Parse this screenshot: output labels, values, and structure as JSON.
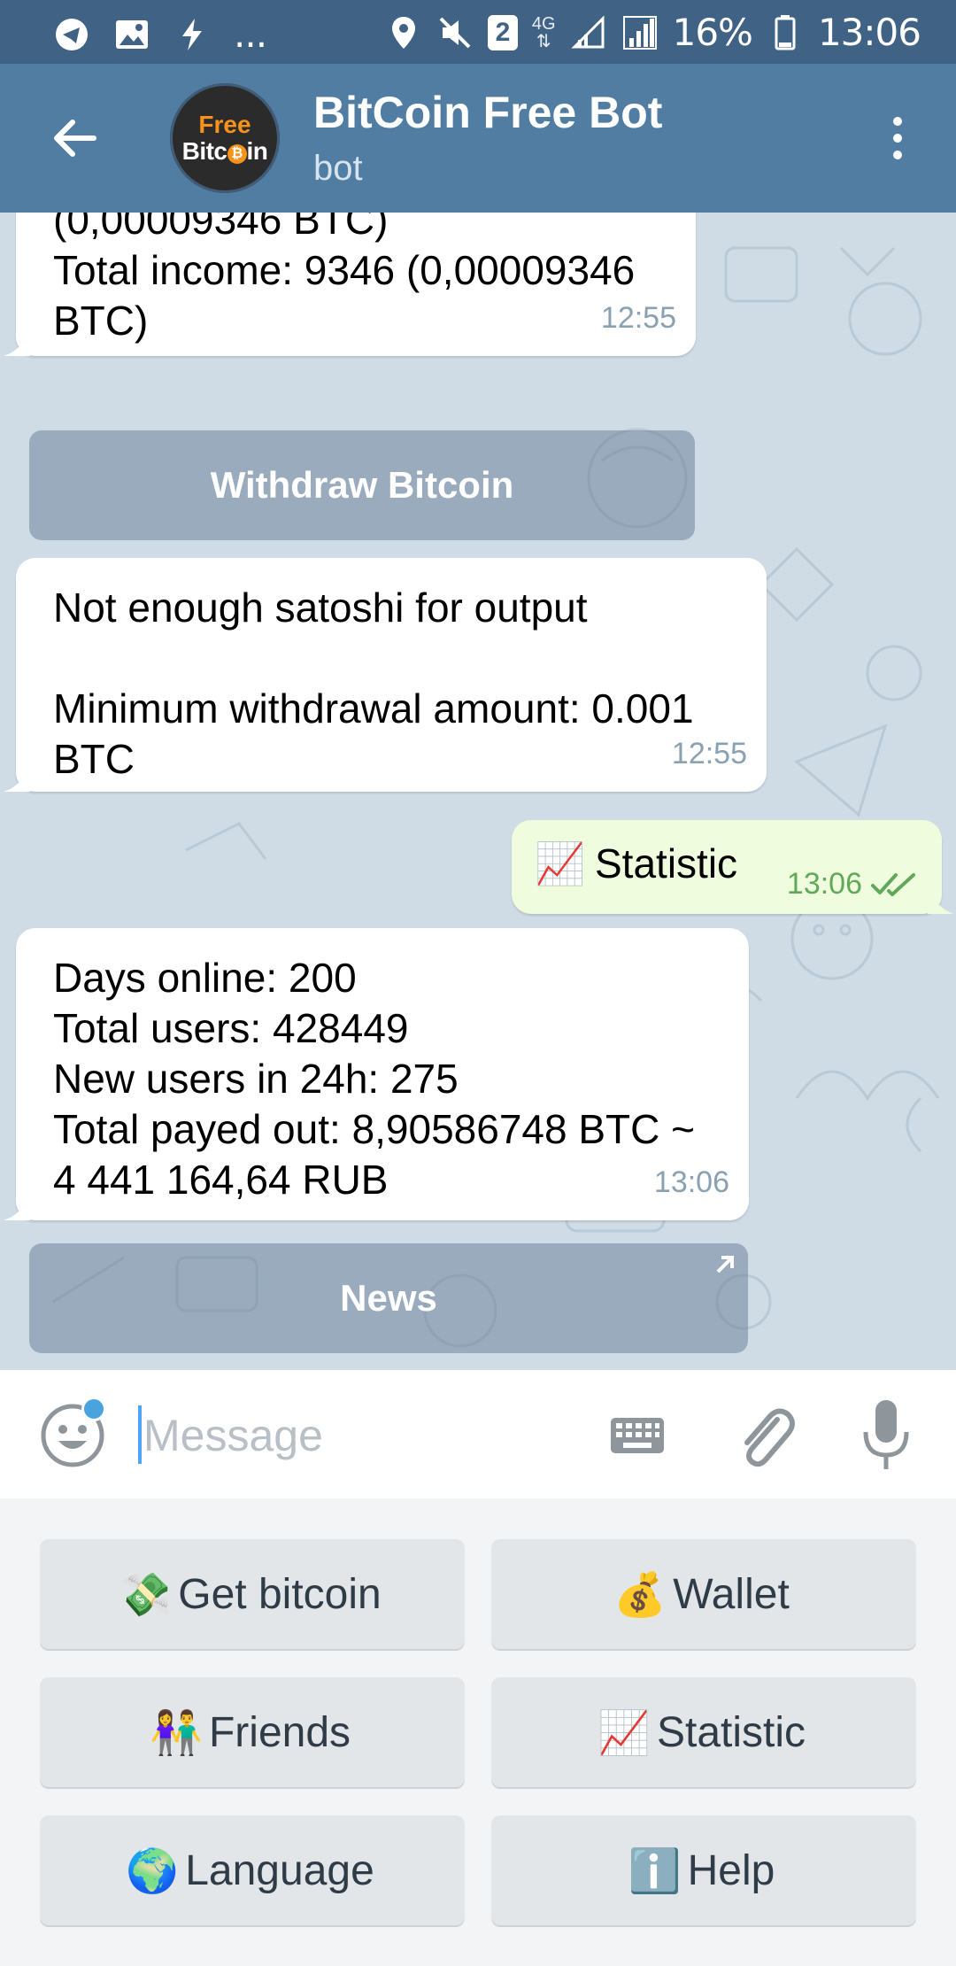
{
  "status_bar": {
    "left_icons": [
      "telegram-icon",
      "image-icon",
      "flash-icon"
    ],
    "more": "...",
    "sim": "2",
    "network": "4G",
    "battery": "16%",
    "time": "13:06"
  },
  "header": {
    "avatar_line1": "Free",
    "avatar_line2a": "Bitc",
    "avatar_coin": "₿",
    "avatar_line2b": "in",
    "title": "BitCoin Free Bot",
    "subtitle": "bot"
  },
  "messages": [
    {
      "cut_text": "(0,00009346 BTC)",
      "text": "Total income: 9346 (0,00009346\nBTC)",
      "time": "12:55"
    },
    {
      "text": "Not enough satoshi for output\n\nMinimum withdrawal amount: 0.001\nBTC",
      "time": "12:55"
    },
    {
      "emoji": "📈",
      "text": "Statistic",
      "time": "13:06"
    },
    {
      "text": "Days online: 200\nTotal users: 428449\nNew users in 24h: 275\nTotal payed out: 8,90586748 BTC ~\n4 441 164,64 RUB",
      "time": "13:06"
    }
  ],
  "inline_buttons": {
    "withdraw": "Withdraw Bitcoin",
    "news": "News"
  },
  "input": {
    "placeholder": "Message"
  },
  "keyboard": [
    {
      "emoji": "💸",
      "label": "Get bitcoin"
    },
    {
      "emoji": "💰",
      "label": "Wallet"
    },
    {
      "emoji": "👫",
      "label": "Friends"
    },
    {
      "emoji": "📈",
      "label": "Statistic"
    },
    {
      "emoji": "🌍",
      "label": "Language"
    },
    {
      "emoji": "ℹ️",
      "label": "Help"
    }
  ],
  "colors": {
    "header": "#517da2",
    "status_bar": "#3f6285",
    "chat_bg": "#cfdbe5",
    "outgoing_bubble": "#effdde",
    "check_marks": "#62a85a"
  }
}
